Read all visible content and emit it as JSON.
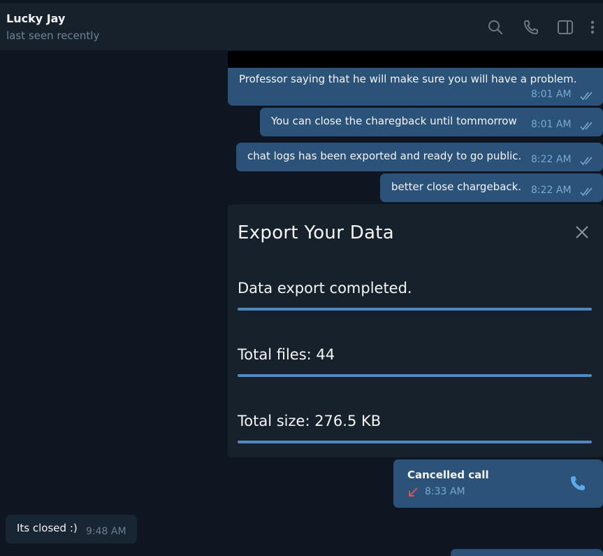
{
  "header": {
    "title": "Lucky Jay",
    "subtitle": "last seen recently",
    "icons": [
      "search-icon",
      "phone-icon",
      "sidebar-toggle-icon",
      "more-vertical-icon"
    ]
  },
  "messages": [
    {
      "text": "Professor saying that he will make sure you will have a problem.",
      "time": "8:01 AM"
    },
    {
      "text": "You can close the charegback until tommorrow",
      "time": "8:01 AM"
    },
    {
      "text": "chat logs has been exported and ready to go public.",
      "time": "8:22 AM"
    },
    {
      "text": "better close chargeback.",
      "time": "8:22 AM"
    }
  ],
  "export_dialog": {
    "title": "Export Your Data",
    "status": "Data export completed.",
    "total_files": "Total files: 44",
    "total_size": "Total size: 276.5 KB"
  },
  "call": {
    "title": "Cancelled call",
    "time": "8:33 AM"
  },
  "incoming": {
    "text": "Its closed :)",
    "time": "9:48 AM"
  },
  "colors": {
    "background": "#0e1621",
    "header": "#17212b",
    "outgoing_bubble": "#2b5278",
    "incoming_bubble": "#182533",
    "accent": "#5288c1",
    "missed_call": "#e5534b"
  }
}
